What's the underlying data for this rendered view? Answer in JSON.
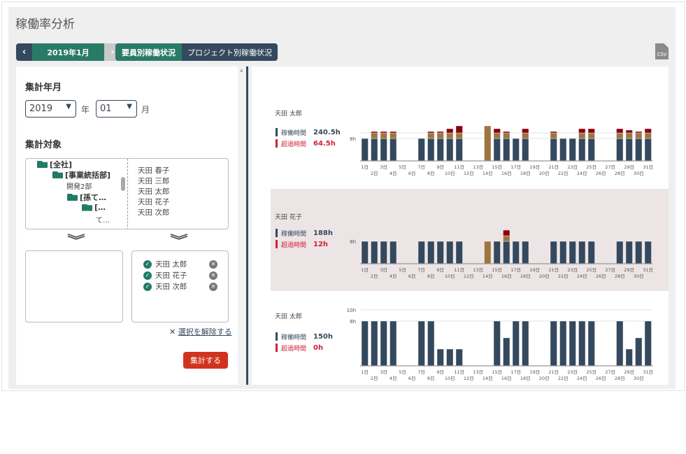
{
  "page_title": "稼働率分析",
  "nav": {
    "prev": "‹",
    "month": "2019年1月",
    "next": "›"
  },
  "tabs": [
    {
      "label": "要員別稼働状況",
      "active": true
    },
    {
      "label": "プロジェクト別稼働状況",
      "active": false
    }
  ],
  "csv_icon": "CSV",
  "left": {
    "period_heading": "集計年月",
    "year": "2019",
    "year_unit": "年",
    "month": "01",
    "month_unit": "月",
    "target_heading": "集計対象",
    "tree": [
      "[全社]",
      "[事業統括部]",
      "開発2部",
      "[孫て…",
      "[…",
      "て…"
    ],
    "members": [
      "天田 春子",
      "天田 三郎",
      "天田 太郎",
      "天田 花子",
      "天田 次郎"
    ],
    "selected": [
      "天田 太郎",
      "天田 花子",
      "天田 次郎"
    ],
    "clear_label": "選択を解除する",
    "run_label": "集計する"
  },
  "collapse_label": "«",
  "colors": {
    "regular": "#34495e",
    "overtime": "#9c7540",
    "excess": "#8b0012",
    "accent": "#2a7a68",
    "danger": "#d0341f"
  },
  "chart_data": [
    {
      "type": "bar",
      "stacked": true,
      "name": "天田 太郎",
      "work_label": "稼働時間",
      "work_total": "240.5h",
      "over_label": "超過時間",
      "over_total": "64.5h",
      "categories": [
        "1日",
        "2日",
        "3日",
        "4日",
        "5日",
        "6日",
        "7日",
        "8日",
        "9日",
        "10日",
        "11日",
        "12日",
        "13日",
        "14日",
        "15日",
        "16日",
        "17日",
        "18日",
        "19日",
        "20日",
        "21日",
        "22日",
        "23日",
        "24日",
        "25日",
        "26日",
        "27日",
        "28日",
        "29日",
        "30日",
        "31日"
      ],
      "yticks": [
        "8h"
      ],
      "ytick_values": [
        8
      ],
      "gridlines": [
        8,
        10
      ],
      "ylim": [
        0,
        15
      ],
      "series": [
        {
          "key": "regular",
          "values": [
            8,
            8,
            8,
            8,
            0,
            0,
            8,
            8,
            8,
            8,
            8,
            0,
            0,
            0,
            8,
            8,
            8,
            8,
            0,
            0,
            8,
            8,
            8,
            8,
            8,
            0,
            0,
            8,
            8,
            8,
            8
          ]
        },
        {
          "key": "overtime",
          "values": [
            0,
            2,
            2,
            2,
            0,
            0,
            0,
            2,
            2,
            2,
            2,
            0,
            0,
            12.5,
            2,
            2,
            0,
            2,
            0,
            0,
            2,
            0,
            0,
            2,
            2,
            0,
            0,
            2,
            2,
            2,
            2
          ]
        },
        {
          "key": "excess",
          "values": [
            0,
            0.5,
            0.5,
            0.5,
            0,
            0,
            0,
            0.5,
            0.5,
            1.5,
            2.5,
            0,
            0,
            0,
            1.5,
            0.5,
            0,
            1.5,
            0,
            0,
            0.5,
            0,
            0,
            1.5,
            1.5,
            0,
            0,
            1.5,
            1,
            0.5,
            1.5
          ]
        }
      ]
    },
    {
      "type": "bar",
      "stacked": true,
      "name": "天田 花子",
      "work_label": "稼働時間",
      "work_total": "188h",
      "over_label": "超過時間",
      "over_total": "12h",
      "categories": [
        "1日",
        "2日",
        "3日",
        "4日",
        "5日",
        "6日",
        "7日",
        "8日",
        "9日",
        "10日",
        "11日",
        "12日",
        "13日",
        "14日",
        "15日",
        "16日",
        "17日",
        "18日",
        "19日",
        "20日",
        "21日",
        "22日",
        "23日",
        "24日",
        "25日",
        "26日",
        "27日",
        "28日",
        "29日",
        "30日",
        "31日"
      ],
      "yticks": [
        "8h"
      ],
      "ytick_values": [
        8
      ],
      "gridlines": [],
      "ylim": [
        0,
        15
      ],
      "series": [
        {
          "key": "regular",
          "values": [
            8,
            8,
            8,
            8,
            0,
            0,
            8,
            8,
            8,
            8,
            8,
            0,
            0,
            0,
            8,
            8,
            8,
            8,
            0,
            0,
            8,
            8,
            8,
            8,
            8,
            0,
            0,
            8,
            8,
            8,
            8
          ]
        },
        {
          "key": "overtime",
          "values": [
            0,
            0,
            0,
            0,
            0,
            0,
            0,
            0,
            0,
            0,
            0,
            0,
            0,
            8,
            0,
            2,
            0,
            0,
            0,
            0,
            0,
            0,
            0,
            0,
            0,
            0,
            0,
            0,
            0,
            0,
            0
          ]
        },
        {
          "key": "excess",
          "values": [
            0,
            0,
            0,
            0,
            0,
            0,
            0,
            0,
            0,
            0,
            0,
            0,
            0,
            0,
            0,
            2,
            0,
            0,
            0,
            0,
            0,
            0,
            0,
            0,
            0,
            0,
            0,
            0,
            0,
            0,
            0
          ]
        }
      ]
    },
    {
      "type": "bar",
      "stacked": true,
      "name": "天田 太郎",
      "work_label": "稼働時間",
      "work_total": "150h",
      "over_label": "超過時間",
      "over_total": "0h",
      "categories": [
        "1日",
        "2日",
        "3日",
        "4日",
        "5日",
        "6日",
        "7日",
        "8日",
        "9日",
        "10日",
        "11日",
        "12日",
        "13日",
        "14日",
        "15日",
        "16日",
        "17日",
        "18日",
        "19日",
        "20日",
        "21日",
        "22日",
        "23日",
        "24日",
        "25日",
        "26日",
        "27日",
        "28日",
        "29日",
        "30日",
        "31日"
      ],
      "yticks": [
        "10h",
        "8h"
      ],
      "ytick_values": [
        10,
        8
      ],
      "gridlines": [
        10,
        8
      ],
      "ylim": [
        0,
        10.5
      ],
      "series": [
        {
          "key": "regular",
          "values": [
            8,
            8,
            8,
            8,
            0,
            0,
            8,
            8,
            3,
            3,
            3,
            0,
            0,
            0,
            8,
            5,
            8,
            8,
            0,
            0,
            8,
            8,
            8,
            8,
            8,
            0,
            0,
            8,
            3,
            5,
            8
          ]
        },
        {
          "key": "overtime",
          "values": [
            0,
            0,
            0,
            0,
            0,
            0,
            0,
            0,
            0,
            0,
            0,
            0,
            0,
            0,
            0,
            0,
            0,
            0,
            0,
            0,
            0,
            0,
            0,
            0,
            0,
            0,
            0,
            0,
            0,
            0,
            0
          ]
        },
        {
          "key": "excess",
          "values": [
            0,
            0,
            0,
            0,
            0,
            0,
            0,
            0,
            0,
            0,
            0,
            0,
            0,
            0,
            0,
            0,
            0,
            0,
            0,
            0,
            0,
            0,
            0,
            0,
            0,
            0,
            0,
            0,
            0,
            0,
            0
          ]
        }
      ]
    }
  ]
}
